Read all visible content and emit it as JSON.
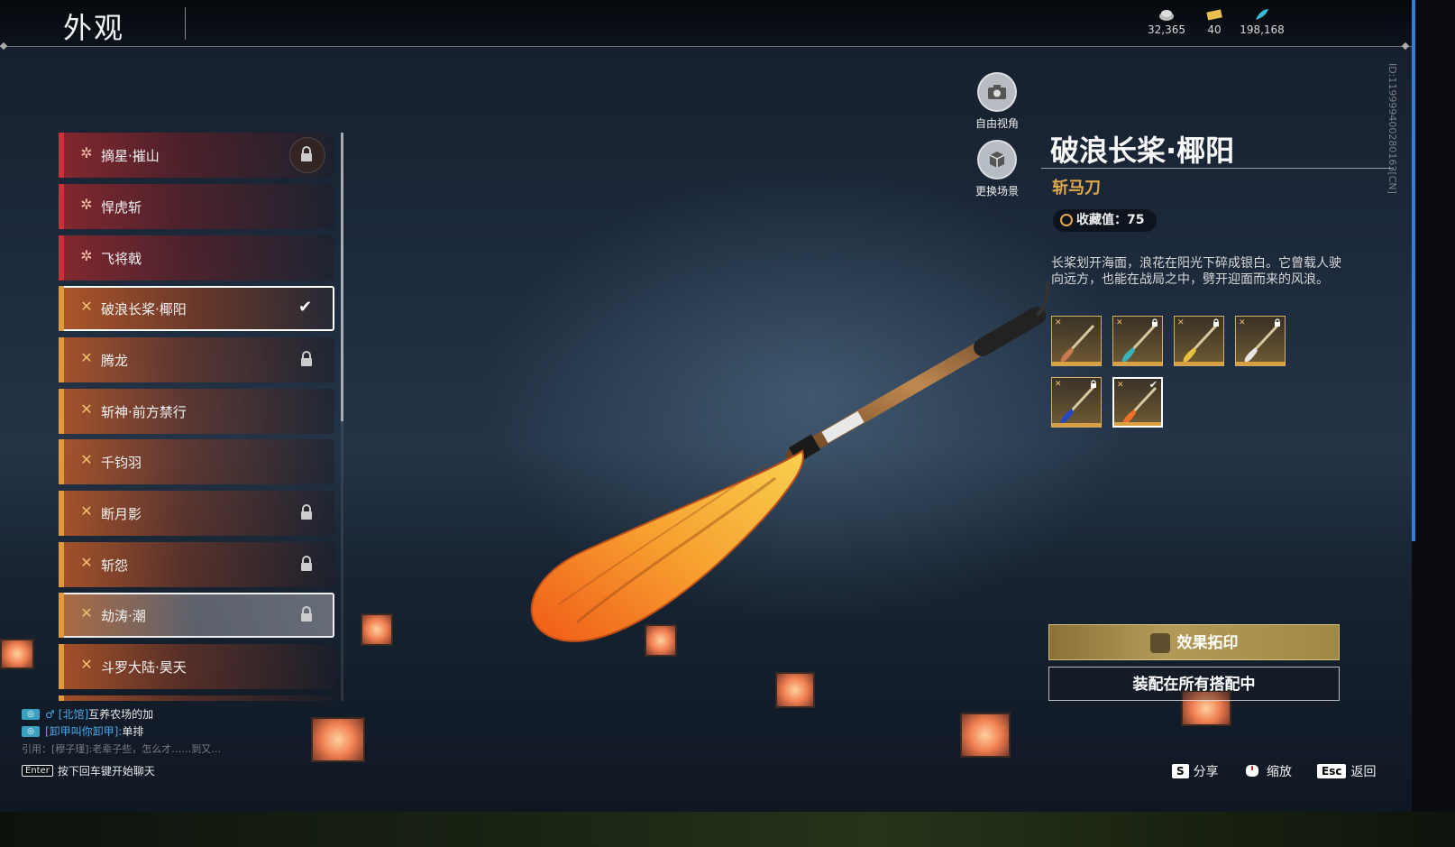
{
  "topbar": {
    "title": "外观",
    "currencies": [
      {
        "icon": "coin-stack-icon",
        "value": "32,365"
      },
      {
        "icon": "ticket-icon",
        "value": "40"
      },
      {
        "icon": "feather-icon",
        "value": "198,168"
      }
    ]
  },
  "id_label": "ID:119999400280163[CN]",
  "list": {
    "items": [
      {
        "label": "摘星·摧山",
        "rarity": "red",
        "locked": true
      },
      {
        "label": "悍虎斩",
        "rarity": "red",
        "locked": false
      },
      {
        "label": "飞将戟",
        "rarity": "red",
        "locked": false
      },
      {
        "label": "破浪长桨·椰阳",
        "rarity": "gold",
        "locked": false,
        "selected": true
      },
      {
        "label": "腾龙",
        "rarity": "gold",
        "locked": true
      },
      {
        "label": "斩神·前方禁行",
        "rarity": "gold",
        "locked": false
      },
      {
        "label": "千钧羽",
        "rarity": "gold",
        "locked": false
      },
      {
        "label": "断月影",
        "rarity": "gold",
        "locked": true
      },
      {
        "label": "斩怨",
        "rarity": "gold",
        "locked": true
      },
      {
        "label": "劫涛·潮",
        "rarity": "gold",
        "locked": true,
        "highlighted": true
      },
      {
        "label": "斗罗大陆·昊天",
        "rarity": "gold",
        "locked": false
      }
    ]
  },
  "camera": {
    "free_view": "自由视角",
    "change_scene": "更换场景"
  },
  "detail": {
    "name": "破浪长桨·椰阳",
    "type": "斩马刀",
    "collect_label": "收藏值：",
    "collect_value": "75",
    "description": "长桨划开海面，浪花在阳光下碎成银白。它曾载人驶向远方，也能在战局之中，劈开迎面而来的风浪。",
    "skins": [
      {
        "color": "#c87a50",
        "locked": false,
        "selected": false
      },
      {
        "color": "#3ab0b8",
        "locked": true,
        "selected": false
      },
      {
        "color": "#e8c040",
        "locked": true,
        "selected": false
      },
      {
        "color": "#e8e8e8",
        "locked": true,
        "selected": false
      },
      {
        "color": "#2848c0",
        "locked": true,
        "selected": false
      },
      {
        "color": "#f07028",
        "locked": false,
        "selected": true
      }
    ],
    "imprint_button": "效果拓印",
    "equip_button": "装配在所有搭配中"
  },
  "chat": {
    "rows": [
      {
        "channel": "[北馆]",
        "gender": "♂",
        "text": "互养农场的加"
      },
      {
        "channel": "[卸甲叫你卸甲]:",
        "gender": "",
        "text": "单排"
      }
    ],
    "quote": "引用：[穆子瑾]:老辈子些，怎么才……到又…",
    "hint_key": "Enter",
    "hint_text": "按下回车键开始聊天"
  },
  "hints": [
    {
      "key": "S",
      "label": "分享"
    },
    {
      "key": "",
      "label": "缩放"
    },
    {
      "key": "Esc",
      "label": "返回"
    }
  ]
}
